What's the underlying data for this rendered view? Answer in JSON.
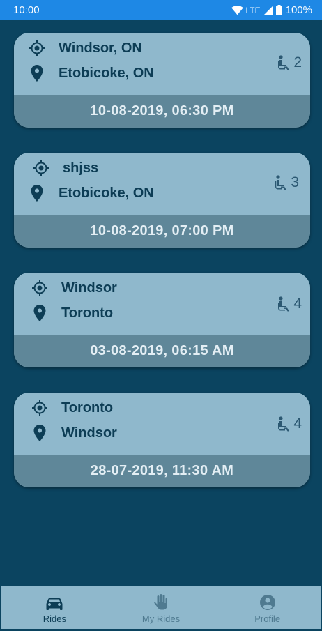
{
  "status_bar": {
    "time": "10:00",
    "network": "LTE",
    "battery": "100%"
  },
  "rides": [
    {
      "from": "Windsor, ON",
      "to": "Etobicoke, ON",
      "seats": "2",
      "datetime": "10-08-2019, 06:30 PM"
    },
    {
      "from": "shjss",
      "to": "Etobicoke, ON",
      "seats": "3",
      "datetime": "10-08-2019, 07:00 PM"
    },
    {
      "from": "Windsor",
      "to": "Toronto",
      "seats": "4",
      "datetime": "03-08-2019, 06:15 AM"
    },
    {
      "from": "Toronto",
      "to": "Windsor",
      "seats": "4",
      "datetime": "28-07-2019, 11:30 AM"
    }
  ],
  "bottom_nav": {
    "items": [
      {
        "label": "Rides",
        "icon": "car-icon",
        "active": true
      },
      {
        "label": "My Rides",
        "icon": "hand-icon",
        "active": false
      },
      {
        "label": "Profile",
        "icon": "account-icon",
        "active": false
      }
    ]
  },
  "colors": {
    "status_bar": "#1e88e5",
    "background": "#0b4460",
    "card": "#8fb8cc",
    "card_footer": "#5f8799",
    "text_dark": "#0d3d55"
  }
}
